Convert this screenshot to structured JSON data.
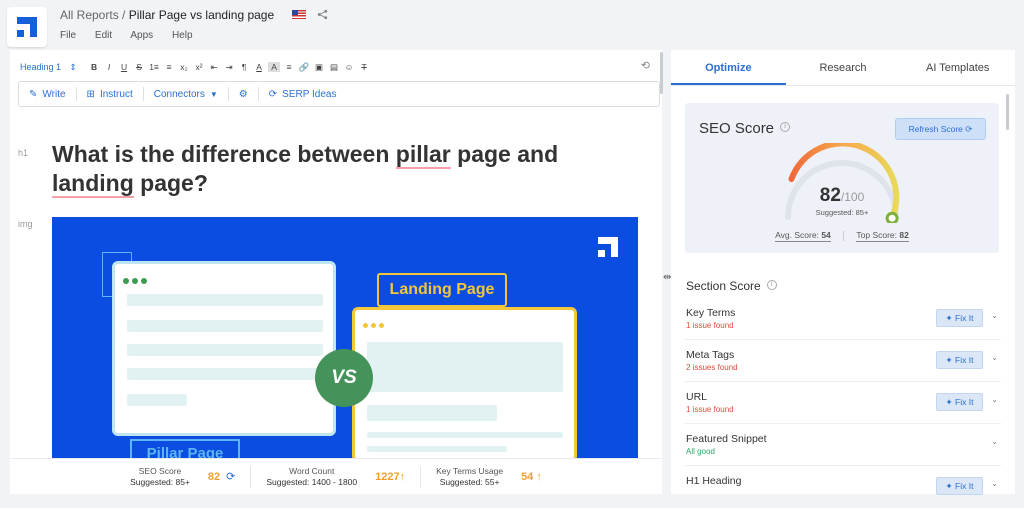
{
  "header": {
    "breadcrumb_root": "All Reports",
    "breadcrumb_sep": "/",
    "title": "Pillar Page vs landing page",
    "menu": [
      "File",
      "Edit",
      "Apps",
      "Help"
    ]
  },
  "toolbar": {
    "heading_select": "Heading 1",
    "format_icons": [
      "B",
      "I",
      "U",
      "S",
      "1≡",
      "≡",
      "x₂",
      "x²",
      "⇤",
      "⇥",
      "¶",
      "A",
      "A",
      "≡",
      "🔗",
      "▣",
      "▤",
      "☺",
      "T"
    ],
    "actions": [
      {
        "icon": "pencil-icon",
        "label": "Write"
      },
      {
        "icon": "grid-icon",
        "label": "Instruct"
      },
      {
        "icon": "caret-down-icon",
        "label": "Connectors"
      },
      {
        "icon": "gear-icon",
        "label": ""
      },
      {
        "icon": "refresh-icon",
        "label": "SERP Ideas"
      }
    ]
  },
  "editor": {
    "h1_tag": "h1",
    "img_tag": "img",
    "heading_part1": "What is the difference between ",
    "heading_u1": "pillar",
    "heading_part2": " page and",
    "heading_u2": "landing",
    "heading_part3": " page?",
    "image": {
      "landing_label": "Landing Page",
      "pillar_label": "Pillar Page",
      "vs_label": "VS"
    }
  },
  "bottom_stats": [
    {
      "label": "SEO Score",
      "suggested": "Suggested: 85+",
      "value": "82",
      "icon": "refresh-icon"
    },
    {
      "label": "Word Count",
      "suggested": "Suggested: 1400 - 1800",
      "value": "1227↑"
    },
    {
      "label": "Key Terms Usage",
      "suggested": "Suggested: 55+",
      "value": "54 ↑"
    }
  ],
  "panel": {
    "tabs": [
      "Optimize",
      "Research",
      "AI Templates"
    ],
    "seo": {
      "title": "SEO Score",
      "refresh_label": "Refresh Score",
      "score": "82",
      "max": "/100",
      "suggested": "Suggested: 85+",
      "avg_label": "Avg. Score:",
      "avg_value": "54",
      "top_label": "Top Score:",
      "top_value": "82",
      "gauge_fraction": 0.82
    },
    "section_title": "Section Score",
    "fix_label": "Fix It",
    "sections": [
      {
        "name": "Key Terms",
        "status": "1 issue found",
        "fix": true
      },
      {
        "name": "Meta Tags",
        "status": "2 issues found",
        "fix": true
      },
      {
        "name": "URL",
        "status": "1 issue found",
        "fix": true
      },
      {
        "name": "Featured Snippet",
        "status": "All good",
        "fix": false
      },
      {
        "name": "H1 Heading",
        "status": "",
        "fix": true
      }
    ]
  },
  "colors": {
    "accent": "#2c6fd0",
    "image_bg": "#0a4de0",
    "score_orange": "#f0a02a",
    "issue_red": "#e04b3c",
    "good_green": "#2fa96a"
  }
}
